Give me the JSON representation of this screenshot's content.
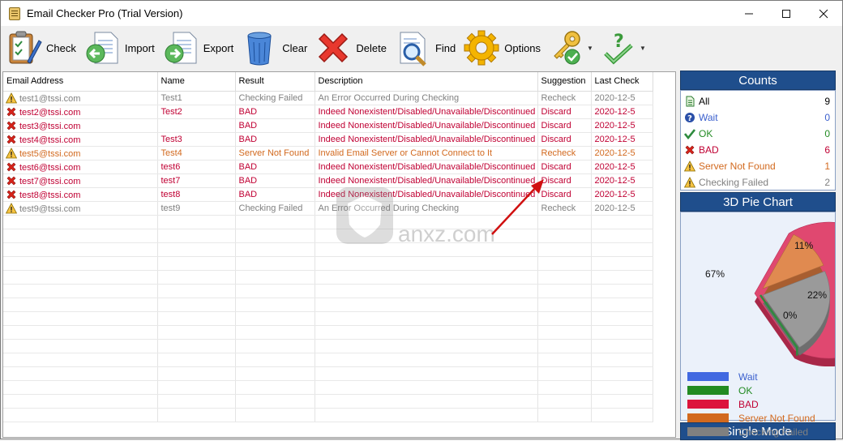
{
  "window": {
    "title": "Email Checker Pro (Trial Version)"
  },
  "toolbar": {
    "check": "Check",
    "import": "Import",
    "export": "Export",
    "clear": "Clear",
    "delete": "Delete",
    "find": "Find",
    "options": "Options"
  },
  "grid": {
    "columns": [
      "Email Address",
      "Name",
      "Result",
      "Description",
      "Suggestion",
      "Last Check"
    ],
    "rows": [
      {
        "icon": "warning-icon",
        "email": "test1@tssi.com",
        "name": "Test1",
        "result": "Checking Failed",
        "description": "An Error Occurred During Checking",
        "suggestion": "Recheck",
        "last_check": "2020-12-5",
        "color": "gray"
      },
      {
        "icon": "red-x-icon",
        "email": "test2@tssi.com",
        "name": "Test2",
        "result": "BAD",
        "description": "Indeed Nonexistent/Disabled/Unavailable/Discontinued",
        "suggestion": "Discard",
        "last_check": "2020-12-5",
        "color": "red"
      },
      {
        "icon": "red-x-icon",
        "email": "test3@tssi.com",
        "name": "",
        "result": "BAD",
        "description": "Indeed Nonexistent/Disabled/Unavailable/Discontinued",
        "suggestion": "Discard",
        "last_check": "2020-12-5",
        "color": "red"
      },
      {
        "icon": "red-x-icon",
        "email": "test4@tssi.com",
        "name": "Test3",
        "result": "BAD",
        "description": "Indeed Nonexistent/Disabled/Unavailable/Discontinued",
        "suggestion": "Discard",
        "last_check": "2020-12-5",
        "color": "red"
      },
      {
        "icon": "warning-icon",
        "email": "test5@tssi.com",
        "name": "Test4",
        "result": "Server Not Found",
        "description": "Invalid Email Server or Cannot Connect to It",
        "suggestion": "Recheck",
        "last_check": "2020-12-5",
        "color": "orange"
      },
      {
        "icon": "red-x-icon",
        "email": "test6@tssi.com",
        "name": "test6",
        "result": "BAD",
        "description": "Indeed Nonexistent/Disabled/Unavailable/Discontinued",
        "suggestion": "Discard",
        "last_check": "2020-12-5",
        "color": "red"
      },
      {
        "icon": "red-x-icon",
        "email": "test7@tssi.com",
        "name": "test7",
        "result": "BAD",
        "description": "Indeed Nonexistent/Disabled/Unavailable/Discontinued",
        "suggestion": "Discard",
        "last_check": "2020-12-5",
        "color": "red"
      },
      {
        "icon": "red-x-icon",
        "email": "test8@tssi.com",
        "name": "test8",
        "result": "BAD",
        "description": "Indeed Nonexistent/Disabled/Unavailable/Discontinued",
        "suggestion": "Discard",
        "last_check": "2020-12-5",
        "color": "red"
      },
      {
        "icon": "warning-icon",
        "email": "test9@tssi.com",
        "name": "test9",
        "result": "Checking Failed",
        "description": "An Error Occurred During Checking",
        "suggestion": "Recheck",
        "last_check": "2020-12-5",
        "color": "gray"
      }
    ]
  },
  "counts": {
    "title": "Counts",
    "items": [
      {
        "label": "All",
        "value": "9",
        "icon": "document-icon",
        "color": "#000000"
      },
      {
        "label": "Wait",
        "value": "0",
        "icon": "question-icon",
        "color": "#3a5fcd"
      },
      {
        "label": "OK",
        "value": "0",
        "icon": "check-icon",
        "color": "#228b22"
      },
      {
        "label": "BAD",
        "value": "6",
        "icon": "red-x-icon",
        "color": "#c00033"
      },
      {
        "label": "Server Not Found",
        "value": "1",
        "icon": "warning-icon",
        "color": "#d2691e"
      },
      {
        "label": "Checking Failed",
        "value": "2",
        "icon": "warning-icon",
        "color": "#808080"
      }
    ]
  },
  "pie": {
    "title": "3D Pie Chart",
    "slices": [
      {
        "label": "67%",
        "value": 67,
        "color": "#e04870"
      },
      {
        "label": "11%",
        "value": 11,
        "color": "#e08a50"
      },
      {
        "label": "22%",
        "value": 22,
        "color": "#9a9a9a"
      },
      {
        "label": "0%",
        "value": 0,
        "color": "#2e8b3e"
      }
    ],
    "legend": [
      {
        "label": "Wait",
        "color": "#4169e1",
        "text_color": "#3a5fcd"
      },
      {
        "label": "OK",
        "color": "#228b22",
        "text_color": "#228b22"
      },
      {
        "label": "BAD",
        "color": "#dc143c",
        "text_color": "#c00033"
      },
      {
        "label": "Server Not Found",
        "color": "#d2691e",
        "text_color": "#d2691e"
      },
      {
        "label": "Checking Failed",
        "color": "#808080",
        "text_color": "#808080"
      }
    ]
  },
  "mode": {
    "label": "Single Mode"
  },
  "watermark": {
    "text": "anxz.com"
  }
}
